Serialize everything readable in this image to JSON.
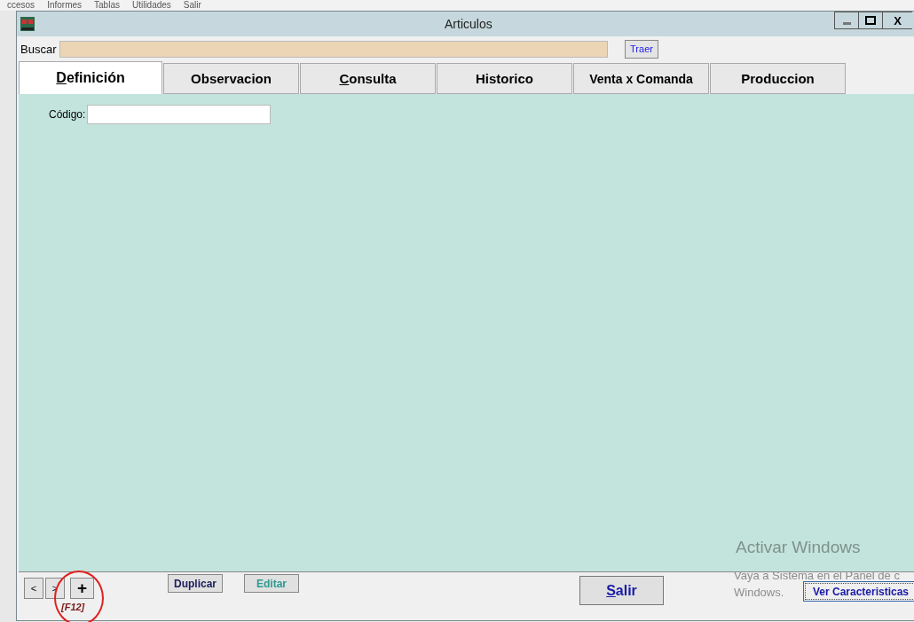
{
  "background_menu": [
    "ccesos",
    "Informes",
    "Tablas",
    "Utilidades",
    "Salir"
  ],
  "window": {
    "title": "Articulos",
    "controls": [
      {
        "kind": "minimize"
      },
      {
        "kind": "maximize"
      },
      {
        "kind": "close",
        "label": "X"
      }
    ]
  },
  "search": {
    "label": "Buscar",
    "button": "Traer"
  },
  "tabs": [
    {
      "label": "Definición",
      "selected": true,
      "underline_first": true
    },
    {
      "label": "Observacion",
      "selected": false,
      "underline_first": false
    },
    {
      "label": "Consulta",
      "selected": false,
      "underline_first": true
    },
    {
      "label": "Historico",
      "selected": false,
      "underline_first": false
    },
    {
      "label": "Venta x Comanda",
      "selected": false,
      "underline_first": false
    },
    {
      "label": "Produccion",
      "selected": false,
      "underline_first": false
    }
  ],
  "fields": [
    {
      "label": "Código:"
    }
  ],
  "footer": {
    "nav": [
      {
        "label": "<",
        "highlighted": false
      },
      {
        "label": ">",
        "highlighted": false
      },
      {
        "label": "+",
        "highlighted": true
      }
    ],
    "shortcut": "[F12]",
    "buttons": [
      {
        "label": "Duplicar",
        "kind": "dark"
      },
      {
        "label": "Editar",
        "kind": "teal"
      }
    ],
    "exit": {
      "label": "Salir",
      "underline_first": true
    },
    "details": "Ver Caracteristicas"
  },
  "activation_notice": {
    "title": "Activar Windows",
    "lines": [
      "Vaya a Sistema en el Panel de c",
      "Windows."
    ]
  }
}
